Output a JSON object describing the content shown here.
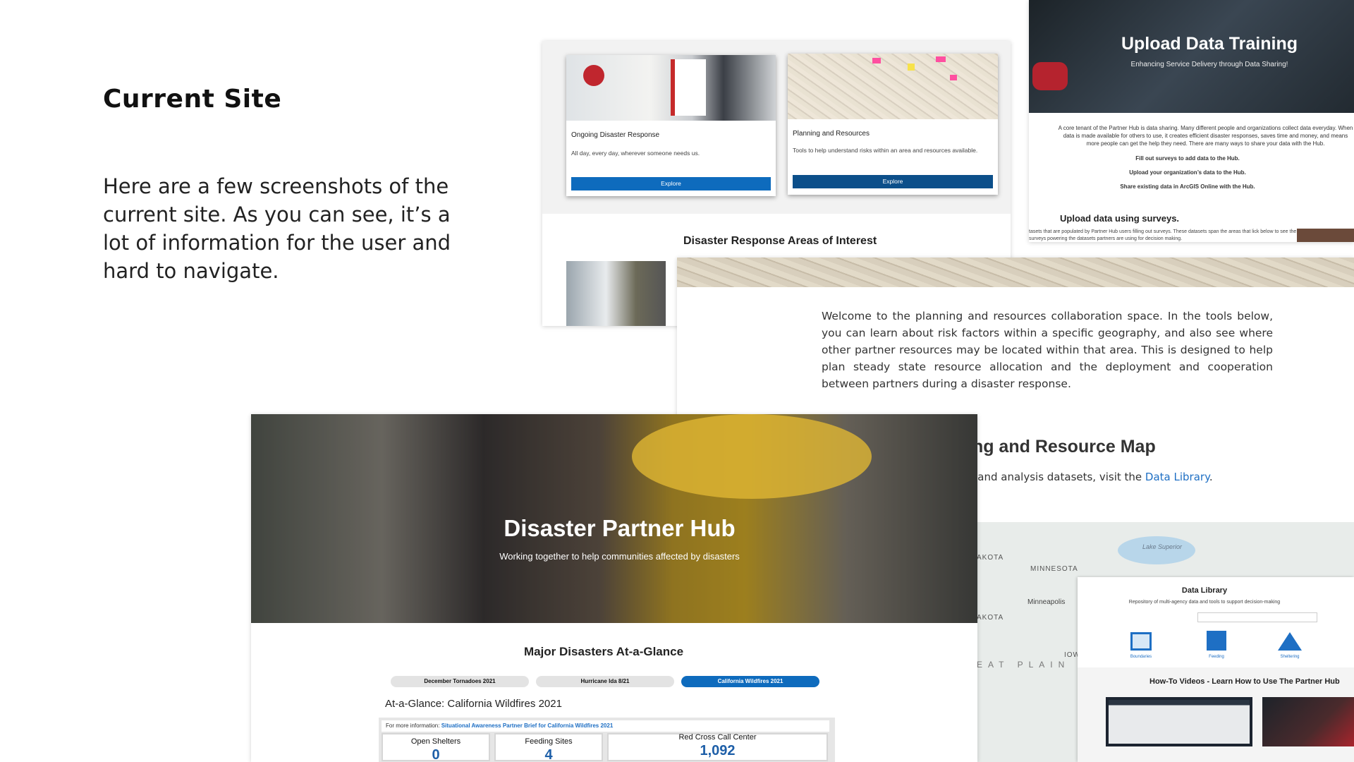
{
  "heading": "Current Site",
  "description": "Here are a few screenshots of the current site. As you can see, it’s a lot of information for the user and hard to navigate.",
  "cards": [
    {
      "title": "Ongoing Disaster Response",
      "text": "All day, every day, wherever someone needs us.",
      "button": "Explore"
    },
    {
      "title": "Planning and Resources",
      "text": "Tools to help understand risks within an area and resources available.",
      "button": "Explore"
    }
  ],
  "areas_heading": "Disaster Response Areas of Interest",
  "upload": {
    "title": "Upload Data Training",
    "subtitle": "Enhancing Service Delivery through Data Sharing!",
    "body": "A core tenant of the Partner Hub is data sharing. Many different people and organizations collect data everyday. When data is made available for others to use, it creates efficient disaster responses, saves time and money, and means more people can get the help they need. There are many ways to share your data with the Hub.",
    "links": [
      "Fill out surveys to add data to the Hub.",
      "Upload your organization’s data to the Hub.",
      "Share existing data in ArcGIS Online with the Hub."
    ],
    "section": "Upload data using surveys.",
    "section_text": "tasets that are populated by Partner Hub users filling out surveys. These datasets span the areas that lick below to see the surveys powering the datasets partners are using for decision making."
  },
  "planning": {
    "welcome": "Welcome to the planning and resources collaboration space. In the tools below, you can learn about risk factors within a specific geography, and also see where other partner resources may be located within that area. This is designed to help plan steady state resource allocation and the deployment and cooperation between partners during a disaster response.",
    "map_heading": "ing and Resource Map",
    "map_text": "g and analysis datasets, visit the",
    "map_link": "Data Library",
    "map_period": "."
  },
  "map_labels": [
    "Lake Superior",
    "MINNESOTA",
    "Minneapolis",
    "AKOTA",
    "AKOTA",
    "IOWA",
    "EAT PLAIN"
  ],
  "library": {
    "title": "Data Library",
    "subtitle": "Repository of multi-agency data and tools to support decision-making",
    "icons": [
      {
        "icon": "boundaries-icon",
        "label": "Boundaries"
      },
      {
        "icon": "feeding-icon",
        "label": "Feeding"
      },
      {
        "icon": "sheltering-icon",
        "label": "Sheltering"
      }
    ],
    "videos_heading": "How-To Videos - Learn How to Use The Partner Hub"
  },
  "hub": {
    "title": "Disaster Partner Hub",
    "subtitle": "Working together to help communities affected by disasters",
    "section": "Major Disasters At-a-Glance",
    "tabs": [
      "December Tornadoes 2021",
      "Hurricane Ida 8/21",
      "California Wildfires 2021"
    ],
    "active_tab": "California Wildfires 2021",
    "glance": "At-a-Glance: California Wildfires 2021",
    "info_prefix": "For more information:",
    "info_link": "Situational Awareness Partner Brief for California Wildfires 2021",
    "stats": [
      {
        "label": "Open Shelters",
        "value": "0"
      },
      {
        "label": "Feeding Sites",
        "value": "4"
      },
      {
        "label": "Red Cross Call Center",
        "value": "1,092"
      }
    ]
  },
  "colors": {
    "accent": "#0e6bbd",
    "button_dark": "#0c4f8a",
    "link": "#1e6fc4"
  }
}
